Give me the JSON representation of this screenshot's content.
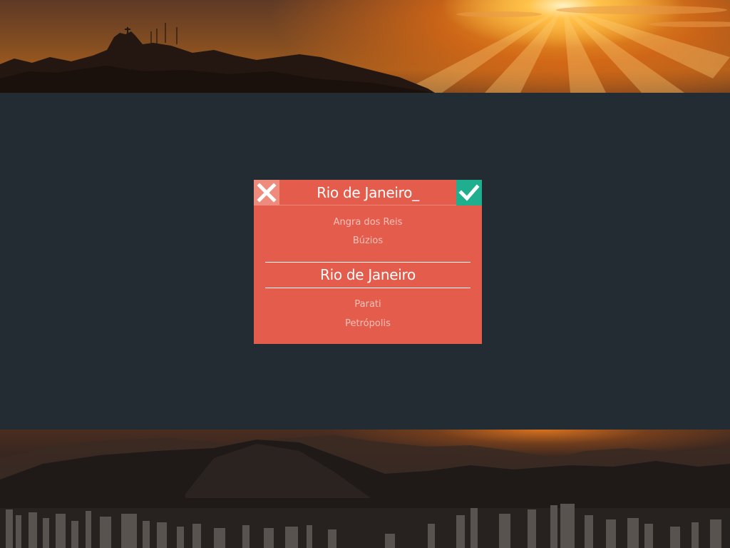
{
  "colors": {
    "background": "#232b33",
    "dialog": "#e45c4b",
    "cancel_button": "#ee8b7c",
    "confirm_button": "#1fae8e"
  },
  "header": {
    "cancel_icon": "close-icon",
    "confirm_icon": "checkmark-icon",
    "search_value": "Rio de Janeiro_"
  },
  "picker": {
    "options_above": [
      "Angra dos Reis",
      "Búzios"
    ],
    "selected": "Rio de Janeiro",
    "options_below": [
      "Parati",
      "Petrópolis"
    ]
  }
}
